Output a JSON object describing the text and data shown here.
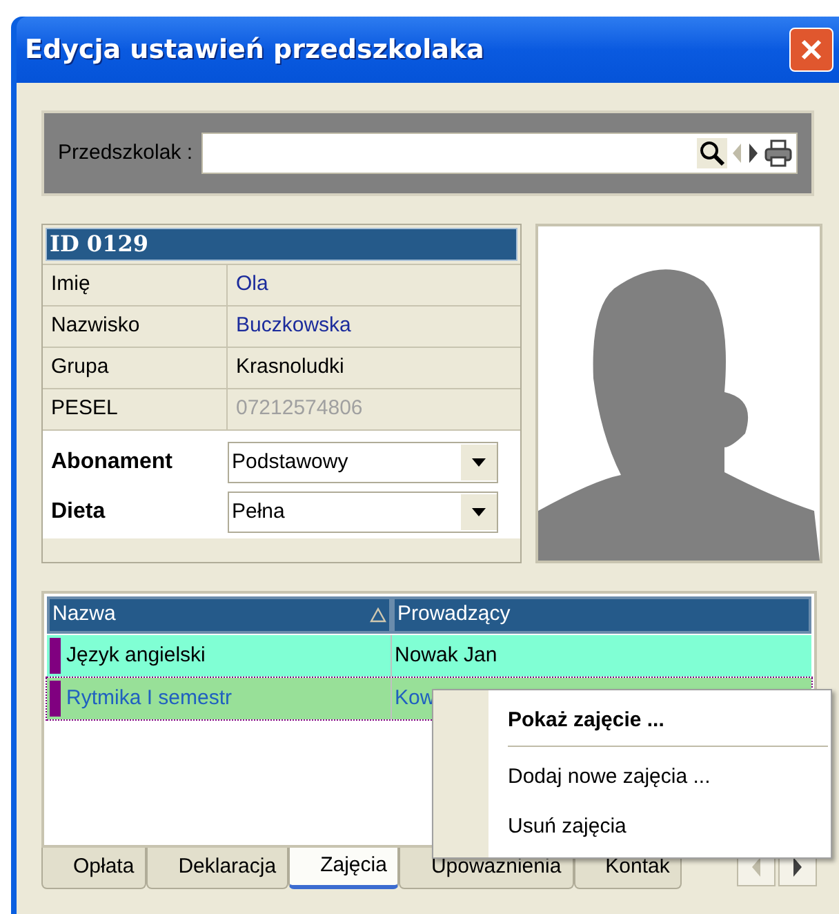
{
  "window": {
    "title": "Edycja ustawień przedszkolaka"
  },
  "search": {
    "label": "Przedszkolak :",
    "nav": [
      {
        "kind": "prev",
        "disabled": true
      },
      {
        "kind": "next",
        "disabled": false
      }
    ]
  },
  "record": {
    "header": "ID 0129",
    "fields": [
      {
        "label": "Imię",
        "value": "Ola",
        "kind": "link"
      },
      {
        "label": "Nazwisko",
        "value": "Buczkowska",
        "kind": "link"
      },
      {
        "label": "Grupa",
        "value": "Krasnoludki",
        "kind": "plain"
      },
      {
        "label": "PESEL",
        "value": "07212574806",
        "kind": "readonly"
      }
    ]
  },
  "options": [
    {
      "label": "Abonament",
      "value": "Podstawowy"
    },
    {
      "label": "Dieta",
      "value": "Pełna"
    }
  ],
  "grid": {
    "columns": [
      {
        "label": "Nazwa",
        "sorted": true
      },
      {
        "label": "Prowadzący",
        "sorted": false
      }
    ],
    "rows": [
      {
        "cells": [
          "Język angielski",
          "Nowak Jan"
        ],
        "color": "#80ffd4",
        "selected": false
      },
      {
        "cells": [
          "Rytmika I semestr",
          "Kow"
        ],
        "color": "#98e098",
        "selected": true
      }
    ]
  },
  "context_menu": {
    "items": [
      {
        "label": "Pokaż zajęcie ...",
        "default": true,
        "separator_after": true
      },
      {
        "label": "Dodaj nowe zajęcia ...",
        "default": false,
        "separator_after": false
      },
      {
        "label": "Usuń zajęcia",
        "default": false,
        "separator_after": false
      }
    ]
  },
  "tabs": [
    {
      "label": "Opłata",
      "selected": false
    },
    {
      "label": "Deklaracja",
      "selected": false
    },
    {
      "label": "Zajęcia",
      "selected": true
    },
    {
      "label": "Upowaznienia",
      "selected": false
    },
    {
      "label": "Kontak",
      "selected": false
    }
  ],
  "tab_scroll": [
    {
      "kind": "prev",
      "disabled": true
    },
    {
      "kind": "next",
      "disabled": false
    }
  ]
}
